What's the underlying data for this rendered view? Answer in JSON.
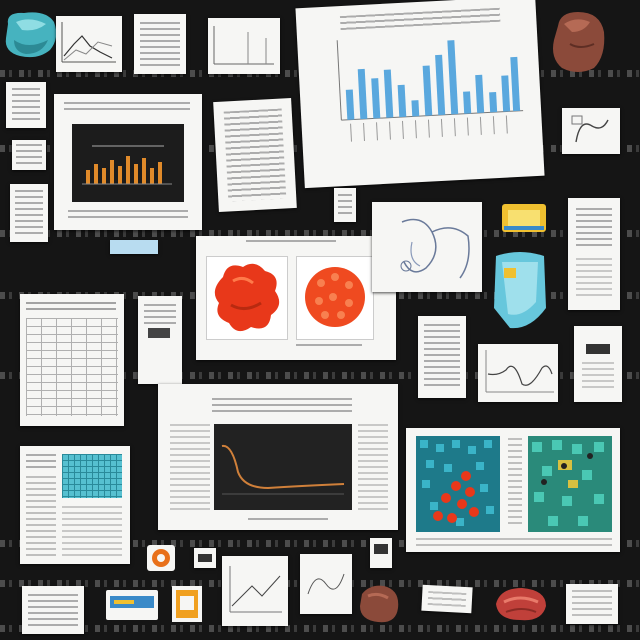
{
  "board": {
    "background": "#151515",
    "item_colors": {
      "paper": "#f6f6f4",
      "teal": "#4bb8c4",
      "orange_red": "#e8381a",
      "brown": "#8b4a3a",
      "chart_blue": "#5aa8de",
      "amber": "#f0a020"
    }
  },
  "items": {
    "teal_object": {
      "icon": "teal-blob-icon"
    },
    "brown_object_top": {
      "icon": "brown-rock-icon"
    },
    "blob_panel": {
      "icon": "protein-blob-icon"
    },
    "lattice_panels": {
      "icon": "heatmap-lattice-icon"
    },
    "sketch": {
      "icon": "line-sketch-icon"
    },
    "sticky_yellow": {
      "icon": "sticky-note-icon"
    },
    "cyan_flask": {
      "icon": "flask-icon"
    },
    "meat_piece": {
      "icon": "meat-slab-icon"
    },
    "brown_object_bottom": {
      "icon": "brown-stone-icon"
    }
  }
}
